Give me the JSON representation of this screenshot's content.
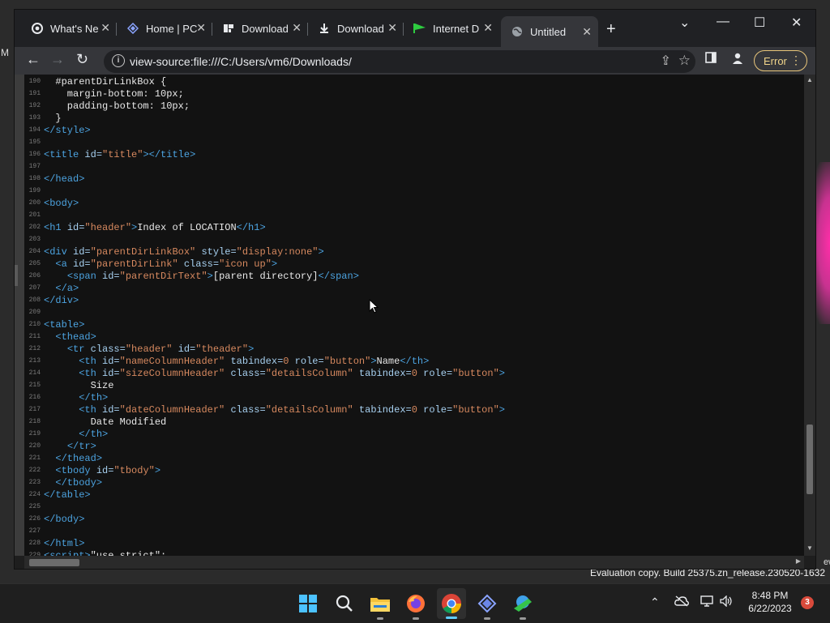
{
  "desktop": {
    "edge_letter": "M",
    "side_sliver_text": "ew",
    "evaluation_text": "Evaluation copy. Build 25375.zn_release.230520-1632"
  },
  "browser": {
    "tabs": [
      {
        "label": "What's Ne",
        "icon": "chrome-icon"
      },
      {
        "label": "Home | PC",
        "icon": "pc-logo-icon"
      },
      {
        "label": "Download",
        "icon": "github-icon"
      },
      {
        "label": "Download",
        "icon": "download-icon"
      },
      {
        "label": "Internet D",
        "icon": "idm-flag-icon"
      },
      {
        "label": "Untitled",
        "icon": "globe-icon",
        "active": true
      }
    ],
    "new_tab_glyph": "+",
    "address": "view-source:file:///C:/Users/vm6/Downloads/",
    "error_label": "Error"
  },
  "source": {
    "lines": [
      {
        "n": "190",
        "parts": [
          [
            "t",
            "  #parentDirLinkBox {"
          ]
        ]
      },
      {
        "n": "191",
        "parts": [
          [
            "t",
            "    margin-bottom: 10px;"
          ]
        ]
      },
      {
        "n": "192",
        "parts": [
          [
            "t",
            "    padding-bottom: 10px;"
          ]
        ]
      },
      {
        "n": "193",
        "parts": [
          [
            "t",
            "  }"
          ]
        ]
      },
      {
        "n": "194",
        "parts": [
          [
            "tag",
            "</style>"
          ]
        ]
      },
      {
        "n": "195",
        "parts": []
      },
      {
        "n": "196",
        "parts": [
          [
            "tag",
            "<title "
          ],
          [
            "attr",
            "id="
          ],
          [
            "val",
            "\"title\""
          ],
          [
            "tag",
            ">"
          ],
          [
            "tag",
            "</title>"
          ]
        ]
      },
      {
        "n": "197",
        "parts": []
      },
      {
        "n": "198",
        "parts": [
          [
            "tag",
            "</head>"
          ]
        ]
      },
      {
        "n": "199",
        "parts": []
      },
      {
        "n": "200",
        "parts": [
          [
            "tag",
            "<body>"
          ]
        ]
      },
      {
        "n": "201",
        "parts": []
      },
      {
        "n": "202",
        "parts": [
          [
            "tag",
            "<h1 "
          ],
          [
            "attr",
            "id="
          ],
          [
            "val",
            "\"header\""
          ],
          [
            "tag",
            ">"
          ],
          [
            "t",
            "Index of LOCATION"
          ],
          [
            "tag",
            "</h1>"
          ]
        ]
      },
      {
        "n": "203",
        "parts": []
      },
      {
        "n": "204",
        "parts": [
          [
            "tag",
            "<div "
          ],
          [
            "attr",
            "id="
          ],
          [
            "val",
            "\"parentDirLinkBox\""
          ],
          [
            "attr",
            " style="
          ],
          [
            "val",
            "\"display:none\""
          ],
          [
            "tag",
            ">"
          ]
        ]
      },
      {
        "n": "205",
        "parts": [
          [
            "t",
            "  "
          ],
          [
            "tag",
            "<a "
          ],
          [
            "attr",
            "id="
          ],
          [
            "val",
            "\"parentDirLink\""
          ],
          [
            "attr",
            " class="
          ],
          [
            "val",
            "\"icon up\""
          ],
          [
            "tag",
            ">"
          ]
        ]
      },
      {
        "n": "206",
        "parts": [
          [
            "t",
            "    "
          ],
          [
            "tag",
            "<span "
          ],
          [
            "attr",
            "id="
          ],
          [
            "val",
            "\"parentDirText\""
          ],
          [
            "tag",
            ">"
          ],
          [
            "t",
            "[parent directory]"
          ],
          [
            "tag",
            "</span>"
          ]
        ]
      },
      {
        "n": "207",
        "parts": [
          [
            "t",
            "  "
          ],
          [
            "tag",
            "</a>"
          ]
        ]
      },
      {
        "n": "208",
        "parts": [
          [
            "tag",
            "</div>"
          ]
        ]
      },
      {
        "n": "209",
        "parts": []
      },
      {
        "n": "210",
        "parts": [
          [
            "tag",
            "<table>"
          ]
        ]
      },
      {
        "n": "211",
        "parts": [
          [
            "t",
            "  "
          ],
          [
            "tag",
            "<thead>"
          ]
        ]
      },
      {
        "n": "212",
        "parts": [
          [
            "t",
            "    "
          ],
          [
            "tag",
            "<tr "
          ],
          [
            "attr",
            "class="
          ],
          [
            "val",
            "\"header\""
          ],
          [
            "attr",
            " id="
          ],
          [
            "val",
            "\"theader\""
          ],
          [
            "tag",
            ">"
          ]
        ]
      },
      {
        "n": "213",
        "parts": [
          [
            "t",
            "      "
          ],
          [
            "tag",
            "<th "
          ],
          [
            "attr",
            "id="
          ],
          [
            "val",
            "\"nameColumnHeader\""
          ],
          [
            "attr",
            " tabindex="
          ],
          [
            "val",
            "0"
          ],
          [
            "attr",
            " role="
          ],
          [
            "val",
            "\"button\""
          ],
          [
            "tag",
            ">"
          ],
          [
            "t",
            "Name"
          ],
          [
            "tag",
            "</th>"
          ]
        ]
      },
      {
        "n": "214",
        "parts": [
          [
            "t",
            "      "
          ],
          [
            "tag",
            "<th "
          ],
          [
            "attr",
            "id="
          ],
          [
            "val",
            "\"sizeColumnHeader\""
          ],
          [
            "attr",
            " class="
          ],
          [
            "val",
            "\"detailsColumn\""
          ],
          [
            "attr",
            " tabindex="
          ],
          [
            "val",
            "0"
          ],
          [
            "attr",
            " role="
          ],
          [
            "val",
            "\"button\""
          ],
          [
            "tag",
            ">"
          ]
        ]
      },
      {
        "n": "215",
        "parts": [
          [
            "t",
            "        Size"
          ]
        ]
      },
      {
        "n": "216",
        "parts": [
          [
            "t",
            "      "
          ],
          [
            "tag",
            "</th>"
          ]
        ]
      },
      {
        "n": "217",
        "parts": [
          [
            "t",
            "      "
          ],
          [
            "tag",
            "<th "
          ],
          [
            "attr",
            "id="
          ],
          [
            "val",
            "\"dateColumnHeader\""
          ],
          [
            "attr",
            " class="
          ],
          [
            "val",
            "\"detailsColumn\""
          ],
          [
            "attr",
            " tabindex="
          ],
          [
            "val",
            "0"
          ],
          [
            "attr",
            " role="
          ],
          [
            "val",
            "\"button\""
          ],
          [
            "tag",
            ">"
          ]
        ]
      },
      {
        "n": "218",
        "parts": [
          [
            "t",
            "        Date Modified"
          ]
        ]
      },
      {
        "n": "219",
        "parts": [
          [
            "t",
            "      "
          ],
          [
            "tag",
            "</th>"
          ]
        ]
      },
      {
        "n": "220",
        "parts": [
          [
            "t",
            "    "
          ],
          [
            "tag",
            "</tr>"
          ]
        ]
      },
      {
        "n": "221",
        "parts": [
          [
            "t",
            "  "
          ],
          [
            "tag",
            "</thead>"
          ]
        ]
      },
      {
        "n": "222",
        "parts": [
          [
            "t",
            "  "
          ],
          [
            "tag",
            "<tbody "
          ],
          [
            "attr",
            "id="
          ],
          [
            "val",
            "\"tbody\""
          ],
          [
            "tag",
            ">"
          ]
        ]
      },
      {
        "n": "223",
        "parts": [
          [
            "t",
            "  "
          ],
          [
            "tag",
            "</tbody>"
          ]
        ]
      },
      {
        "n": "224",
        "parts": [
          [
            "tag",
            "</table>"
          ]
        ]
      },
      {
        "n": "225",
        "parts": []
      },
      {
        "n": "226",
        "parts": [
          [
            "tag",
            "</body>"
          ]
        ]
      },
      {
        "n": "227",
        "parts": []
      },
      {
        "n": "228",
        "parts": [
          [
            "tag",
            "</html>"
          ]
        ]
      },
      {
        "n": "229",
        "parts": [
          [
            "tag",
            "<script>"
          ],
          [
            "t",
            "\"use strict\";"
          ]
        ]
      }
    ]
  },
  "taskbar": {
    "apps": [
      "start-button",
      "search",
      "file-explorer",
      "firefox",
      "chrome",
      "pc-app",
      "network-app"
    ],
    "clock_time": "8:48 PM",
    "clock_date": "6/22/2023",
    "notification_count": "3"
  },
  "colors": {
    "tag": "#4ca3e0",
    "attribute": "#a7d0f0",
    "value": "#d7895f",
    "text": "#e8e8e8",
    "error_accent": "#f0d48a",
    "chrome_red": "#db4437",
    "notification": "#d94a3b"
  }
}
